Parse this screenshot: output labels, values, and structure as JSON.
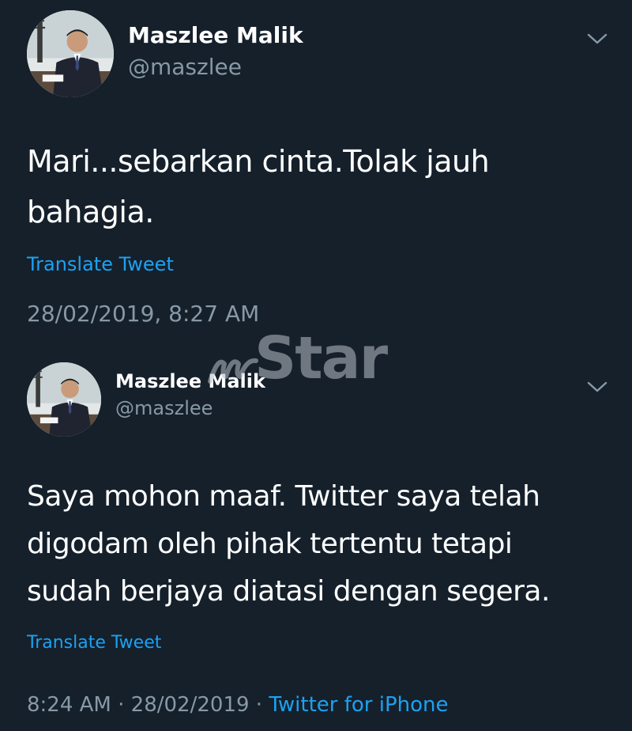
{
  "tweets": [
    {
      "display_name": "Maszlee Malik",
      "handle": "@maszlee",
      "text": "Mari...sebarkan cinta.Tolak jauh bahagia.",
      "translate_label": "Translate Tweet",
      "timestamp": "28/02/2019, 8:27 AM"
    },
    {
      "display_name": "Maszlee Malik",
      "handle": "@maszlee",
      "text": "Saya mohon maaf. Twitter saya telah digodam oleh pihak tertentu tetapi sudah berjaya diatasi dengan segera.",
      "translate_label": "Translate Tweet",
      "time": "8:24 AM",
      "separator": " · ",
      "date": "28/02/2019",
      "source": "Twitter for iPhone"
    }
  ],
  "watermark": {
    "text": "Star"
  },
  "icons": {
    "menu": "chevron-down-icon",
    "avatar": "profile-photo"
  },
  "colors": {
    "background": "#15202b",
    "primary_text": "#ffffff",
    "secondary_text": "#8899a6",
    "link": "#1da1f2"
  }
}
